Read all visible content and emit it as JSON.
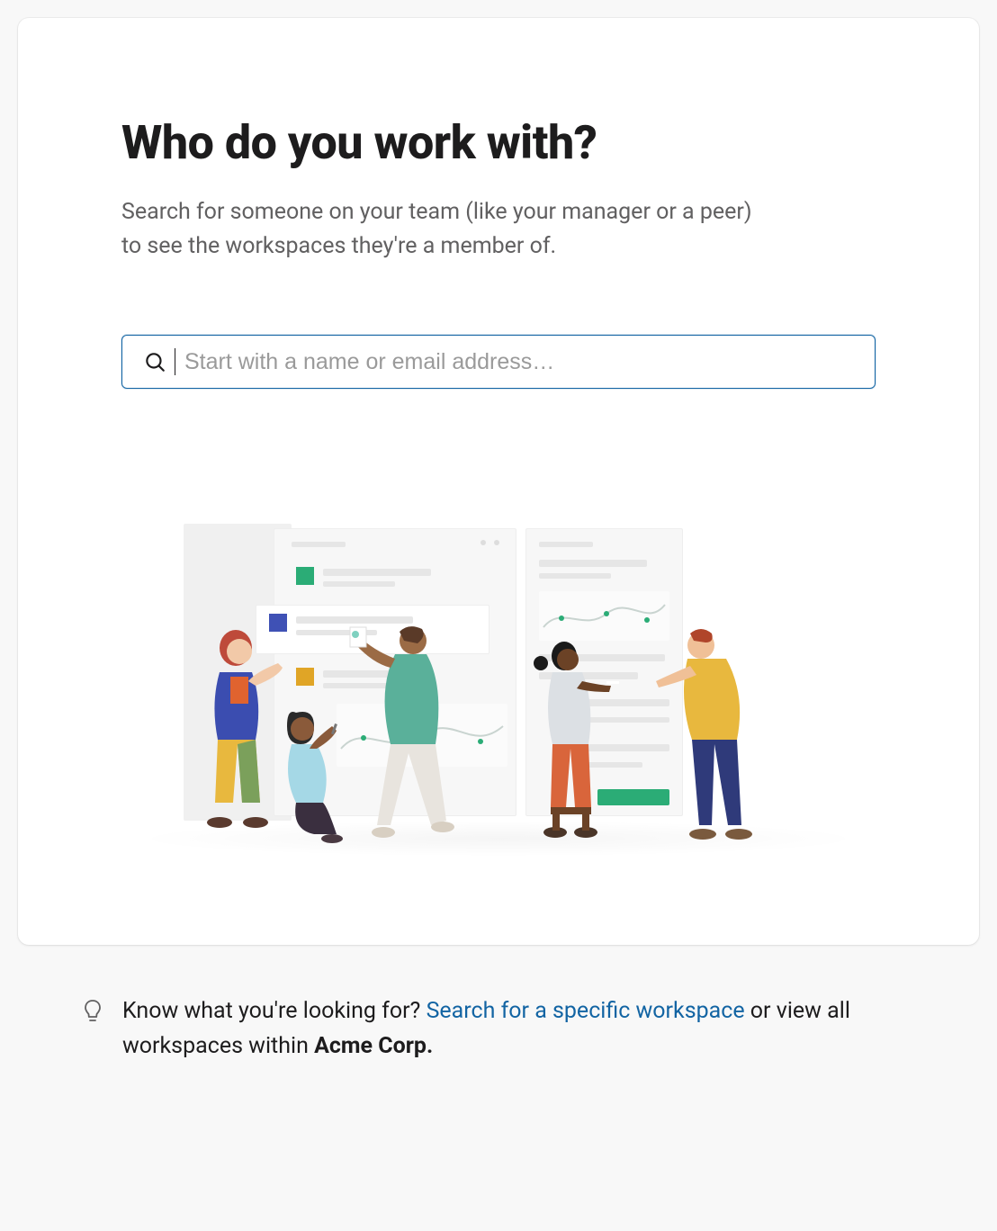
{
  "card": {
    "title": "Who do you work with?",
    "subtitle": "Search for someone on your team (like your manager or a peer) to see the workspaces they're a member of."
  },
  "search": {
    "placeholder": "Start with a name or email address…",
    "value": ""
  },
  "hint": {
    "prefix": "Know what you're looking for? ",
    "link_text": "Search for a specific workspace",
    "middle": " or view all workspaces within ",
    "org_name": "Acme Corp."
  },
  "colors": {
    "accent_link": "#1264a3",
    "teal": "#2bac76"
  }
}
